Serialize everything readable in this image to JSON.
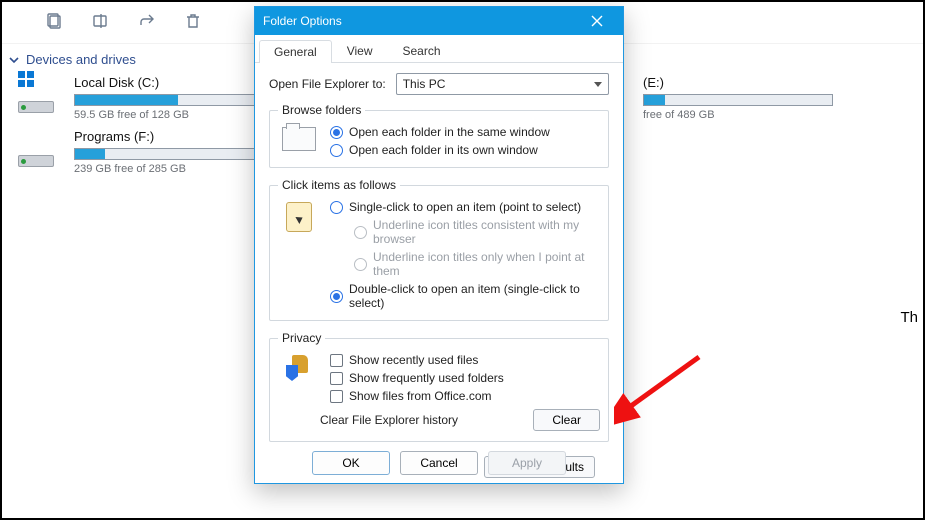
{
  "section_header": "Devices and drives",
  "drives": [
    {
      "title": "Local Disk (C:)",
      "free": "59.5 GB free of 128 GB",
      "fill_pct": 55,
      "variant": "tiles"
    },
    {
      "title": "Programs (F:)",
      "free": "239 GB free of 285 GB",
      "fill_pct": 16,
      "variant": "hdd"
    },
    {
      "title": "(E:)",
      "free": "free of 489 GB",
      "fill_pct": 11,
      "variant": "hdd"
    }
  ],
  "right_text": "Th",
  "dialog": {
    "title": "Folder Options",
    "tabs": {
      "general": "General",
      "view": "View",
      "search": "Search"
    },
    "open_label": "Open File Explorer to:",
    "open_value": "This PC",
    "browse": {
      "legend": "Browse folders",
      "same": "Open each folder in the same window",
      "own": "Open each folder in its own window"
    },
    "click": {
      "legend": "Click items as follows",
      "single": "Single-click to open an item (point to select)",
      "u_browser": "Underline icon titles consistent with my browser",
      "u_point": "Underline icon titles only when I point at them",
      "double": "Double-click to open an item (single-click to select)"
    },
    "privacy": {
      "legend": "Privacy",
      "recent": "Show recently used files",
      "freq": "Show frequently used folders",
      "office": "Show files from Office.com",
      "clear_label": "Clear File Explorer history",
      "clear_btn": "Clear"
    },
    "restore": "Restore Defaults",
    "ok": "OK",
    "cancel": "Cancel",
    "apply": "Apply"
  }
}
